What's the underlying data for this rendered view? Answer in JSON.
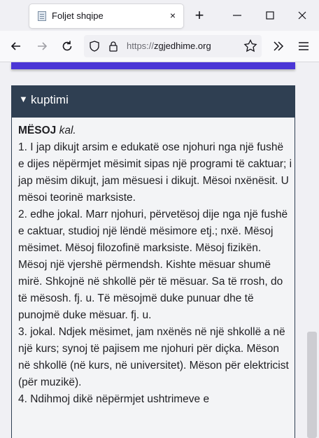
{
  "browser": {
    "tab": {
      "title": "Foljet shqipe",
      "favicon": "document-icon",
      "close": "×"
    },
    "new_tab": "+",
    "window_buttons": [
      "minimize-icon",
      "maximize-icon",
      "close-icon"
    ],
    "nav_icons": [
      "back-arrow-icon",
      "forward-arrow-icon",
      "reload-icon",
      "shield-icon",
      "lock-icon",
      "star-icon",
      "overflow-chevrons-icon",
      "hamburger-menu-icon"
    ],
    "url": {
      "scheme": "https://",
      "host": "zgjedhime.org"
    }
  },
  "page": {
    "accent_color": "#4b36d6",
    "header_color": "#2f3f52",
    "section": {
      "toggle": "▼",
      "title": "kuptimi"
    },
    "entry": {
      "headword": "MËSOJ",
      "pos": "kal.",
      "senses": [
        "1. I jap dikujt arsim e edukatë ose njohuri nga një fushë e dijes nëpërmjet mësimit sipas një programi të caktuar; i jap mësim dikujt, jam mësuesi i dikujt. Mësoi nxënësit. U mësoi teorinë marksiste.",
        "2. edhe jokal. Marr njohuri, përvetësoj dije nga një fushë e caktuar, studioj një lëndë mësimore etj.; nxë. Mësoj mësimet. Mësoj filozofinë marksiste. Mësoj fizikën. Mësoj një vjershë përmendsh. Kishte mësuar shumë mirë. Shkojnë në shkollë për të mësuar. Sa të rrosh, do të mësosh. fj. u. Të mësojmë duke punuar dhe të punojmë duke mësuar. fj. u.",
        "3. jokal. Ndjek mësimet, jam nxënës në një shkollë a në një kurs; synoj të pajisem me njohuri për diçka. Mëson në shkollë (në kurs, në universitet). Mëson për elektricist (për muzikë).",
        "4. Ndihmoj dikë nëpërmjet ushtrimeve e"
      ]
    }
  }
}
